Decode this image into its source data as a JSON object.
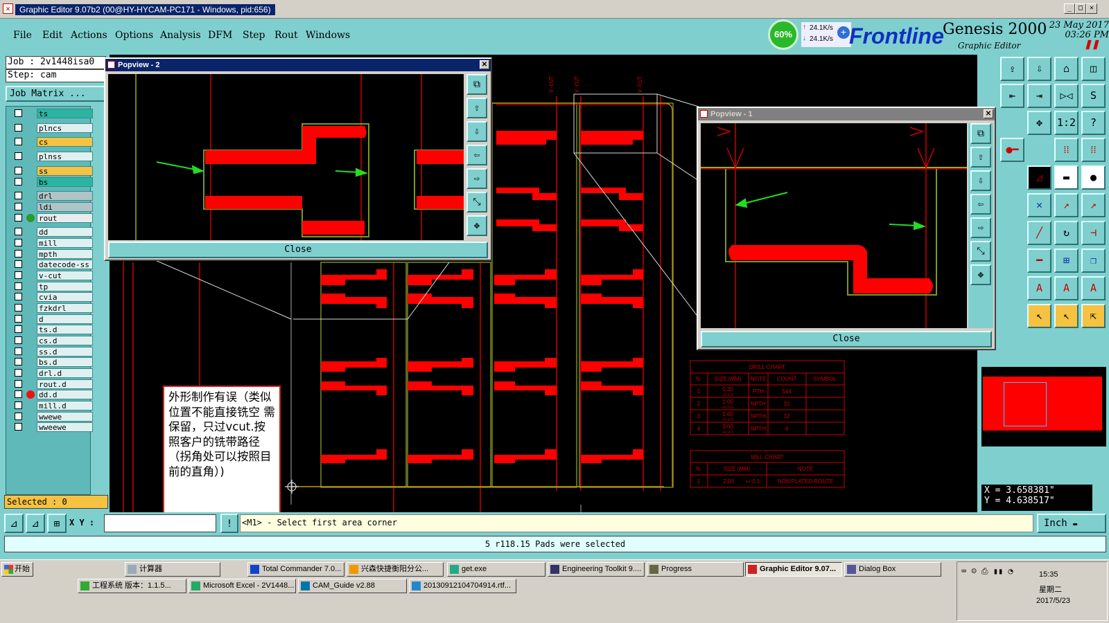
{
  "window": {
    "title": "Graphic Editor 9.07b2 (00@HY-HYCAM-PC171 - Windows, pid:656)"
  },
  "menu": [
    "File",
    "Edit",
    "Actions",
    "Options",
    "Analysis",
    "DFM",
    "Step",
    "Rout",
    "Windows"
  ],
  "system_monitor": {
    "cpu": "60%",
    "upload": "24.1K/s",
    "download": "24.1K/s"
  },
  "brand": {
    "logo": "Frontline",
    "product": "Genesis 2000",
    "subtitle": "Graphic Editor",
    "date": "23 May 2017",
    "time": "03:26 PM"
  },
  "job": {
    "job_line": "Job : 2v1448isa0",
    "step_line": "Step: cam",
    "matrix_button": "Job Matrix ..."
  },
  "layers": [
    {
      "name": "ts",
      "color": "#2bb5a0"
    },
    {
      "name": "plncs",
      "color": "#e0f0f0"
    },
    {
      "name": "cs",
      "color": "#f5c242"
    },
    {
      "name": "plnss",
      "color": "#e0f0f0"
    },
    {
      "name": "ss",
      "color": "#f5c242"
    },
    {
      "name": "bs",
      "color": "#2bb5a0"
    },
    {
      "name": "drl",
      "color": "#b0c4c8"
    },
    {
      "name": "ldi",
      "color": "#b0c4c8"
    },
    {
      "name": "rout",
      "color": "#e8ecec"
    },
    {
      "name": "dd",
      "color": "#e0f0f0"
    },
    {
      "name": "mill",
      "color": "#e0f0f0"
    },
    {
      "name": "mpth",
      "color": "#e0f0f0"
    },
    {
      "name": "datecode-ss",
      "color": "#e0f0f0"
    },
    {
      "name": "v-cut",
      "color": "#e0f0f0"
    },
    {
      "name": "tp",
      "color": "#e0f0f0"
    },
    {
      "name": "cvia",
      "color": "#e0f0f0"
    },
    {
      "name": "fzkdrl",
      "color": "#e0f0f0"
    },
    {
      "name": "d",
      "color": "#e0f0f0"
    },
    {
      "name": "ts.d",
      "color": "#e0f0f0"
    },
    {
      "name": "cs.d",
      "color": "#e0f0f0"
    },
    {
      "name": "ss.d",
      "color": "#e0f0f0"
    },
    {
      "name": "bs.d",
      "color": "#e0f0f0"
    },
    {
      "name": "drl.d",
      "color": "#e0f0f0"
    },
    {
      "name": "rout.d",
      "color": "#e0f0f0"
    },
    {
      "name": "dd.d",
      "color": "#e0f0f0"
    },
    {
      "name": "mill.d",
      "color": "#e0f0f0"
    },
    {
      "name": "wwewe",
      "color": "#e0f0f0"
    },
    {
      "name": "wweewe",
      "color": "#e0f0f0"
    }
  ],
  "selected_label": "Selected : 0",
  "popview2": {
    "title": "Popview - 2",
    "close": "Close"
  },
  "popview1": {
    "title": "Popview - 1",
    "close": "Close"
  },
  "vcut_labels": [
    "V-CUT",
    "V-CUT",
    "V-CUT",
    "V-CUT"
  ],
  "annotation": "外形制作有误（类似位置不能直接铣空 需保留，只过vcut.按照客户的铣带路径（拐角处可以按照目前的直角）)",
  "drill_chart": {
    "title": "DRILL CHART",
    "headers": [
      "N.",
      "SIZE (MM)",
      "NOTE",
      "COUNT",
      "SYMBOL"
    ],
    "rows": [
      [
        "1",
        "0.30",
        "+0.1/-0",
        "PTH",
        "544"
      ],
      [
        "2",
        "1.00",
        "+0.1/-0",
        "NPTH",
        "32"
      ],
      [
        "3",
        "1.60",
        "+0.1/-0",
        "NPTH",
        "32"
      ],
      [
        "4",
        "3.00",
        "+0.1/-0",
        "NPTH",
        "4"
      ]
    ]
  },
  "mill_chart": {
    "title": "MILL CHART",
    "headers": [
      "N.",
      "SIZE (MM)",
      "NOTE"
    ],
    "rows": [
      [
        "1",
        "2.00",
        "+/-0.1",
        "NON PLATED ROUTE"
      ]
    ]
  },
  "coords": {
    "x": "X = 3.658381\"",
    "y": "Y = 4.638517\""
  },
  "command": {
    "xy_label": "X Y :",
    "prompt": "<M1> - Select first area corner",
    "units": "Inch"
  },
  "status": "5 r118.15 Pads were selected",
  "taskbar": {
    "start": "开始",
    "row1": [
      "计算器",
      "Total Commander 7.0...",
      "兴森快捷衡阳分公...",
      "get.exe",
      "Engineering Toolkit 9....",
      "Progress",
      "Graphic Editor 9.07...",
      "Dialog Box"
    ],
    "row2": [
      "工程系统  版本：1.1.5...",
      "Microsoft Excel - 2V1448...",
      "CAM_Guide v2.88",
      "20130912104704914.rtf..."
    ],
    "clock": "15:35",
    "weekday": "星期二",
    "date": "2017/5/23"
  }
}
